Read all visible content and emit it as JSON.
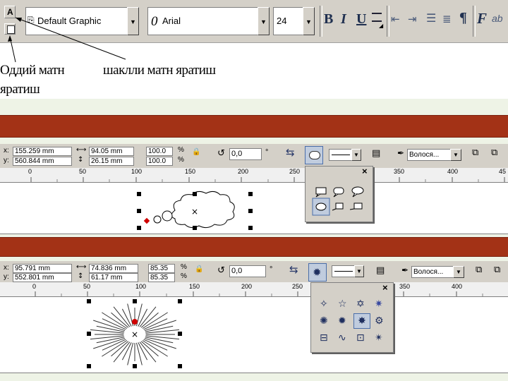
{
  "top_toolbar": {
    "font_style_value": "Default Graphic",
    "font_name_value": "Arial",
    "font_size_value": "24",
    "bold_label": "B",
    "italic_label": "I",
    "underline_label": "U",
    "tools": {
      "paragraph_glyph": "¶",
      "function_glyph": "F",
      "text_sample": "ab"
    }
  },
  "annotations": {
    "simple_text": [
      "Оддий матн",
      "яратиш"
    ],
    "shaped_text": "шаклли матн яратиш"
  },
  "panel1": {
    "x_label": "x:",
    "y_label": "y:",
    "x_value": "155.259 mm",
    "y_value": "560.844 mm",
    "width_value": "94.05 mm",
    "height_value": "26.15 mm",
    "scale_x": "100.0",
    "scale_y": "100.0",
    "percent": "%",
    "angle_value": "0,0",
    "degree": "°",
    "outline_value": "Волося...",
    "ruler_ticks": [
      "0",
      "50",
      "100",
      "150",
      "200",
      "250",
      "350",
      "400",
      "45"
    ],
    "popup_close": "×",
    "popup_shapes": [
      "callout-rect-icon",
      "callout-round-icon",
      "callout-oval-icon",
      "callout-cloud-icon",
      "callout-line-icon",
      "callout-line2-icon"
    ]
  },
  "panel2": {
    "x_label": "x:",
    "y_label": "y:",
    "x_value": "95.791 mm",
    "y_value": "552.801 mm",
    "width_value": "74.836 mm",
    "height_value": "61.17 mm",
    "scale_x": "85.35",
    "scale_y": "85.35",
    "percent": "%",
    "angle_value": "0,0",
    "degree": "°",
    "outline_value": "Волося...",
    "ruler_ticks": [
      "0",
      "50",
      "100",
      "150",
      "200",
      "250",
      "350",
      "400"
    ],
    "popup_close": "×",
    "popup_shapes": [
      "star4-icon",
      "star5-icon",
      "star6-icon",
      "star8-icon",
      "starburst12-icon",
      "starburst16-icon",
      "starburst24-icon",
      "starburst32-icon",
      "banner-icon",
      "wave-icon",
      "scroll-icon",
      "explosion-icon"
    ]
  }
}
